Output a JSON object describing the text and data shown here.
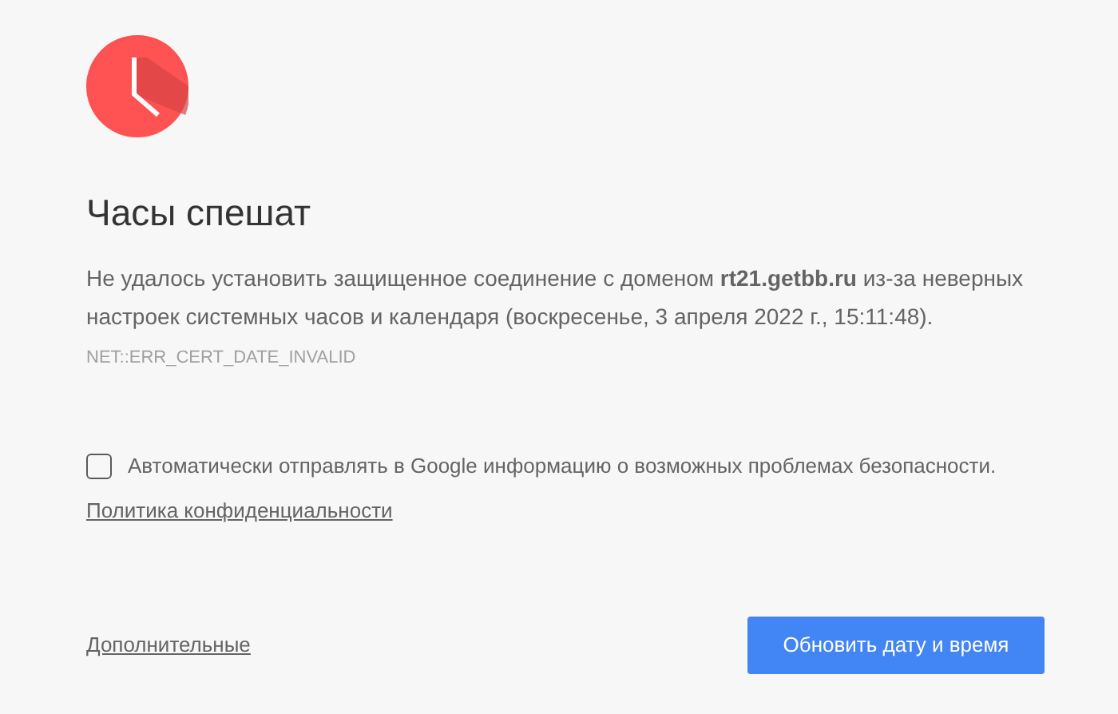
{
  "title": "Часы спешат",
  "message": "Не удалось установить защищенное соединение с доменом **rt21.getbb.ru** из-за неверных настроек системных часов и календаря (воскресенье, 3 апреля 2022 г., 15:11:48).",
  "error_code": "NET::ERR_CERT_DATE_INVALID",
  "report_checkbox": {
    "label": "Автоматически отправлять в Google информацию о возможных проблемах безопасности.",
    "checked": false
  },
  "privacy_link": "Политика конфиденциальности",
  "details_link": "Дополнительные",
  "primary_button": "Обновить дату и время"
}
